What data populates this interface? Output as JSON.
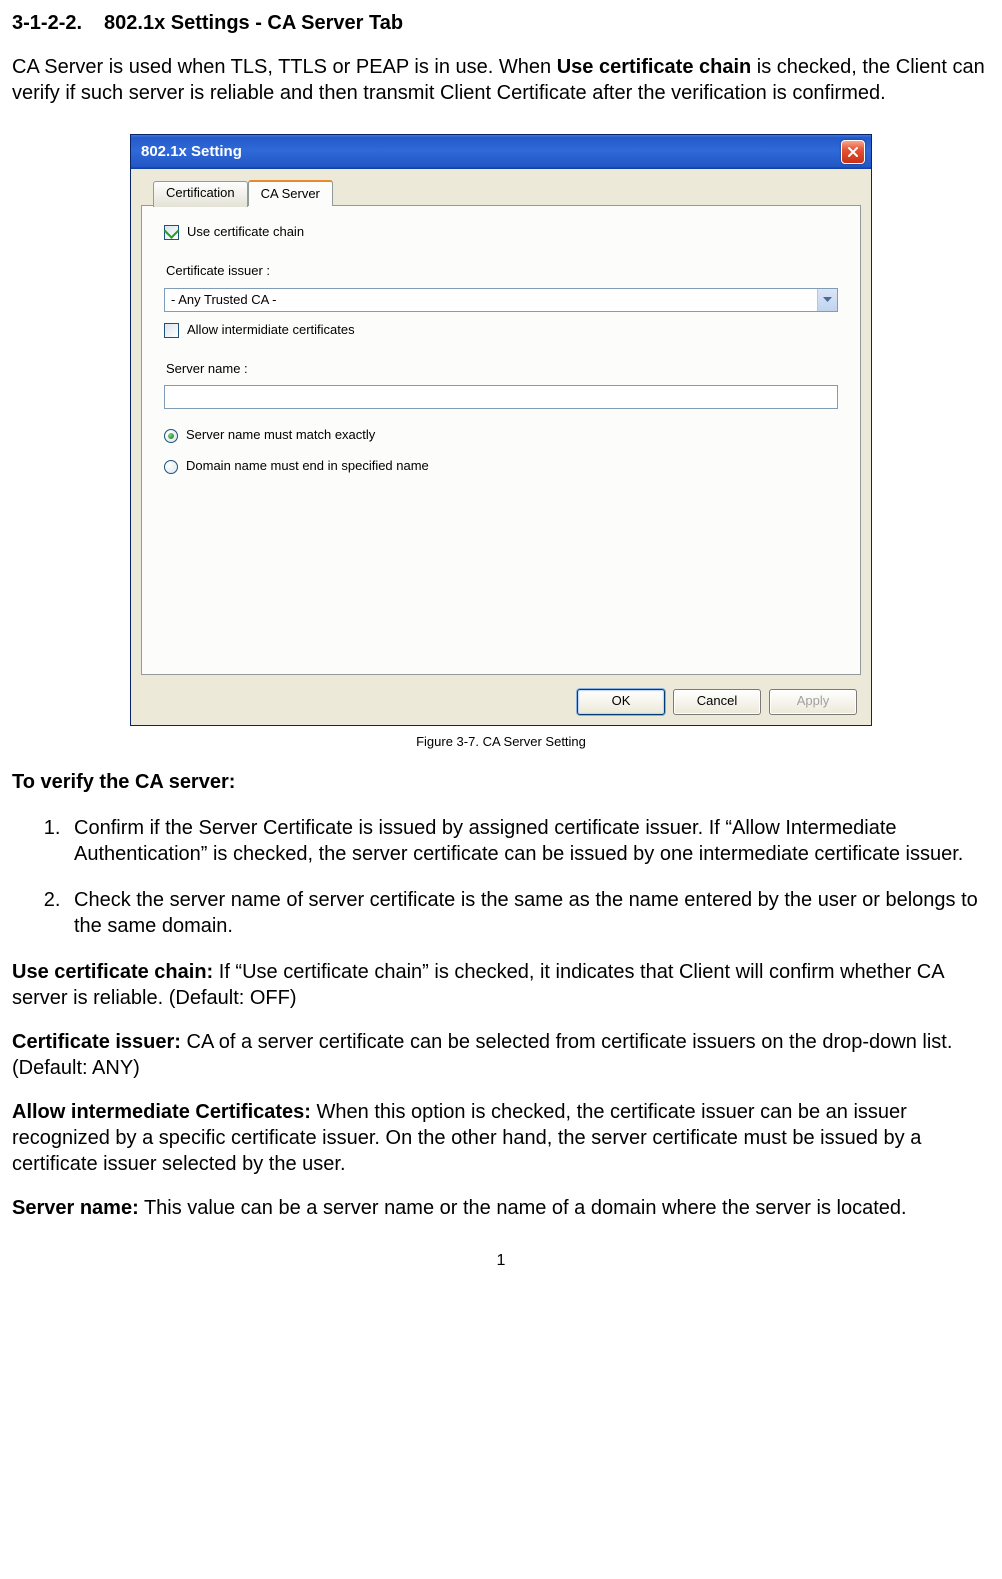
{
  "heading": {
    "number": "3-1-2-2.",
    "title": "802.1x Settings - CA Server Tab"
  },
  "intro": {
    "pre": "CA Server is used when TLS, TTLS or PEAP is in use. When ",
    "bold": "Use certificate chain",
    "post": " is checked, the Client can verify if such server is reliable and then transmit Client Certificate after the verification is confirmed."
  },
  "dialog": {
    "title": "802.1x Setting",
    "tabs": {
      "certification": "Certification",
      "caServer": "CA Server"
    },
    "useCertChain": "Use certificate chain",
    "certIssuerLabel": "Certificate issuer :",
    "certIssuerValue": "- Any Trusted CA -",
    "allowIntermediate": "Allow intermidiate certificates",
    "serverNameLabel": "Server name :",
    "serverNameValue": "",
    "radioExact": "Server name must match exactly",
    "radioDomain": "Domain name must end in specified name",
    "buttons": {
      "ok": "OK",
      "cancel": "Cancel",
      "apply": "Apply"
    }
  },
  "figure": "Figure 3-7.    CA Server Setting",
  "verifyHeading": "To verify the CA server:",
  "steps": [
    "Confirm if the Server Certificate is issued by assigned certificate issuer. If “Allow Intermediate Authentication” is checked, the server certificate can be issued by one intermediate certificate issuer.",
    "Check the server name of server certificate is the same as the name entered by the user or belongs to the same domain."
  ],
  "defs": {
    "useChain": {
      "label": "Use certificate chain:",
      "text": " If “Use certificate chain” is checked, it indicates that Client will confirm whether CA server is reliable. (Default: OFF)"
    },
    "certIssuer": {
      "label": "Certificate issuer:",
      "text": " CA of a server certificate can be selected from certificate issuers on the drop-down list. (Default: ANY)"
    },
    "allowInter": {
      "label": "Allow intermediate Certificates:",
      "text": " When this option is checked, the certificate issuer can be an issuer recognized by a specific certificate issuer. On the other hand, the server certificate must be issued by a certificate issuer selected by the user."
    },
    "serverName": {
      "label": "Server name:",
      "text": " This value can be a server name or the name of a domain where the server is located."
    }
  },
  "pageNumber": "1"
}
